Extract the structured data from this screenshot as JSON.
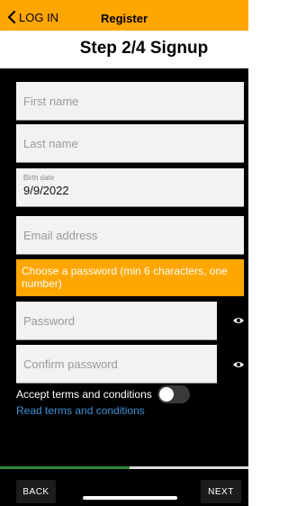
{
  "header": {
    "back_label": "LOG IN",
    "title": "Register",
    "accent_color": "#ffa600"
  },
  "step_title": "Step 2/4 Signup",
  "form": {
    "first_name": {
      "placeholder": "First name"
    },
    "last_name": {
      "placeholder": "Last name"
    },
    "birth_date": {
      "label": "Birth date",
      "value": "9/9/2022"
    },
    "email": {
      "placeholder": "Email address"
    },
    "password_hint": "Choose a password (min 6 characters, one number)",
    "password": {
      "placeholder": "Password"
    },
    "confirm_password": {
      "placeholder": "Confirm password"
    },
    "accept_terms_label": "Accept terms and conditions",
    "accept_terms_on": false,
    "read_terms_link": "Read terms and conditions"
  },
  "progress": {
    "fraction": 0.52,
    "color": "#2e8b2e"
  },
  "footer": {
    "back_button": "BACK",
    "next_button": "NEXT"
  },
  "icons": {
    "back": "chevron-left-icon",
    "show_password": "eye-icon"
  }
}
